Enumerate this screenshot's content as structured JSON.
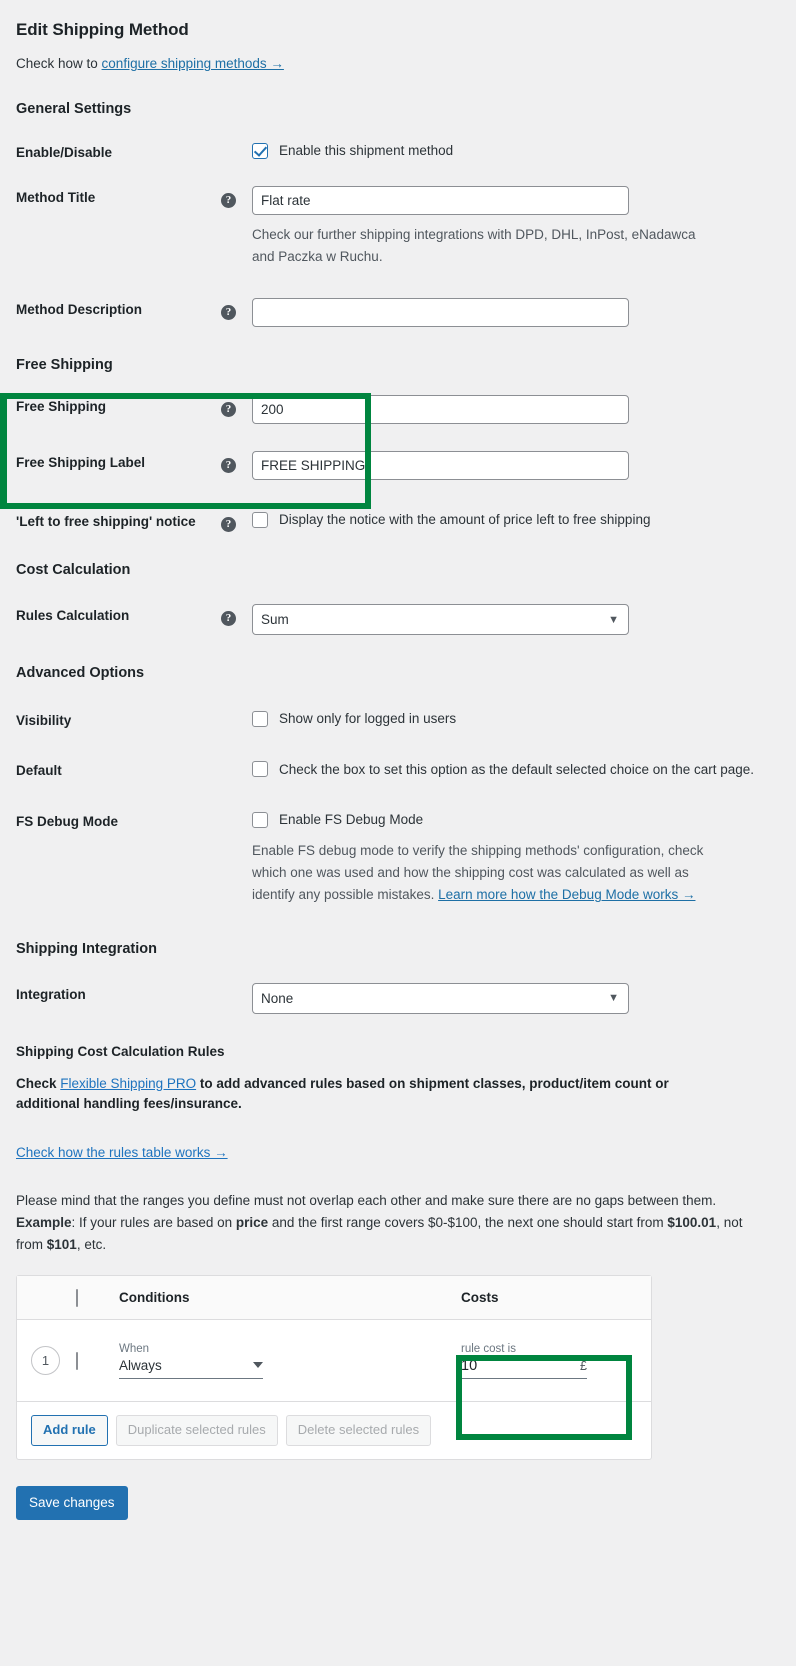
{
  "page": {
    "title": "Edit Shipping Method",
    "subtitle_prefix": "Check how to ",
    "subtitle_link": "configure shipping methods →"
  },
  "sections": {
    "general": "General Settings",
    "free_shipping": "Free Shipping",
    "cost_calculation": "Cost Calculation",
    "advanced": "Advanced Options",
    "shipping_integration": "Shipping Integration"
  },
  "fields": {
    "enable_disable": {
      "label": "Enable/Disable",
      "checkbox_label": "Enable this shipment method",
      "checked": true
    },
    "method_title": {
      "label": "Method Title",
      "value": "Flat rate",
      "description": "Check our further shipping integrations with DPD, DHL, InPost, eNadawca and Paczka w Ruchu."
    },
    "method_description": {
      "label": "Method Description",
      "value": ""
    },
    "free_shipping": {
      "label": "Free Shipping",
      "value": "200"
    },
    "free_shipping_label": {
      "label": "Free Shipping Label",
      "value": "FREE SHIPPING"
    },
    "left_to_free_notice": {
      "label": "'Left to free shipping' notice",
      "checkbox_label": "Display the notice with the amount of price left to free shipping",
      "checked": false
    },
    "rules_calculation": {
      "label": "Rules Calculation",
      "value": "Sum"
    },
    "visibility": {
      "label": "Visibility",
      "checkbox_label": "Show only for logged in users",
      "checked": false
    },
    "default": {
      "label": "Default",
      "checkbox_label": "Check the box to set this option as the default selected choice on the cart page.",
      "checked": false
    },
    "fs_debug_mode": {
      "label": "FS Debug Mode",
      "checkbox_label": "Enable FS Debug Mode",
      "checked": false,
      "description": "Enable FS debug mode to verify the shipping methods' configuration, check which one was used and how the shipping cost was calculated as well as identify any possible mistakes. ",
      "description_link": "Learn more how the Debug Mode works →"
    },
    "integration": {
      "label": "Integration",
      "value": "None"
    }
  },
  "rules": {
    "heading": "Shipping Cost Calculation Rules",
    "promo_prefix": "Check ",
    "promo_link": "Flexible Shipping PRO",
    "promo_suffix": " to add advanced rules based on shipment classes, product/item count or additional handling fees/insurance.",
    "table_works_link": "Check how the rules table works →",
    "mind_text": "Please mind that the ranges you define must not overlap each other and make sure there are no gaps between them.",
    "example_label": "Example",
    "example_p1": ": If your rules are based on ",
    "example_bold_price": "price",
    "example_p2": " and the first range covers $0-$100, the next one should start from ",
    "example_bold_10001": "$100.01",
    "example_p3": ", not from ",
    "example_bold_101": "$101",
    "example_p4": ", etc.",
    "columns": {
      "conditions": "Conditions",
      "costs": "Costs"
    },
    "rows": [
      {
        "number": "1",
        "when_label": "When",
        "condition": "Always",
        "cost_label": "rule cost is",
        "cost_value": "10",
        "currency": "£"
      }
    ],
    "buttons": {
      "add_rule": "Add rule",
      "duplicate": "Duplicate selected rules",
      "delete": "Delete selected rules"
    }
  },
  "footer": {
    "save": "Save changes"
  },
  "colors": {
    "highlight": "#00853f",
    "link": "#1d6fa5",
    "primary": "#2271b1"
  }
}
